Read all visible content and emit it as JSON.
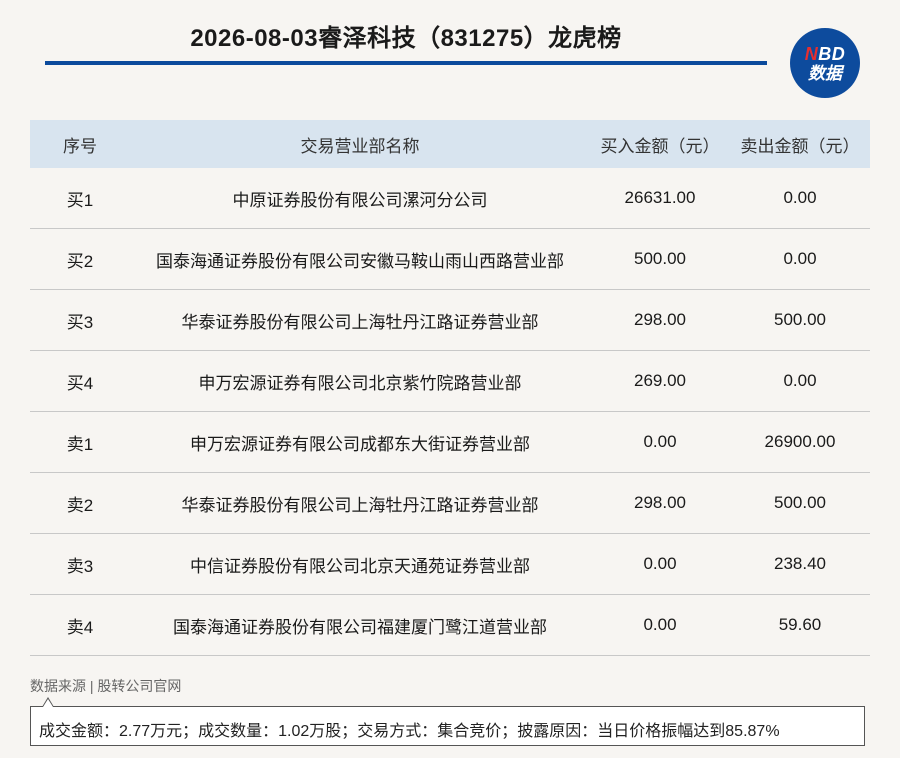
{
  "title": "2026-08-03睿泽科技（831275）龙虎榜",
  "logo": {
    "line1_n": "N",
    "line1_rest": "BD",
    "line2": "数据"
  },
  "table": {
    "headers": [
      "序号",
      "交易营业部名称",
      "买入金额（元）",
      "卖出金额（元）"
    ],
    "rows": [
      [
        "买1",
        "中原证券股份有限公司漯河分公司",
        "26631.00",
        "0.00"
      ],
      [
        "买2",
        "国泰海通证券股份有限公司安徽马鞍山雨山西路营业部",
        "500.00",
        "0.00"
      ],
      [
        "买3",
        "华泰证券股份有限公司上海牡丹江路证券营业部",
        "298.00",
        "500.00"
      ],
      [
        "买4",
        "申万宏源证券有限公司北京紫竹院路营业部",
        "269.00",
        "0.00"
      ],
      [
        "卖1",
        "申万宏源证券有限公司成都东大街证券营业部",
        "0.00",
        "26900.00"
      ],
      [
        "卖2",
        "华泰证券股份有限公司上海牡丹江路证券营业部",
        "298.00",
        "500.00"
      ],
      [
        "卖3",
        "中信证券股份有限公司北京天通苑证券营业部",
        "0.00",
        "238.40"
      ],
      [
        "卖4",
        "国泰海通证券股份有限公司福建厦门鹭江道营业部",
        "0.00",
        "59.60"
      ]
    ]
  },
  "source": "数据来源 | 股转公司官网",
  "note": "成交金额：2.77万元；成交数量：1.02万股；交易方式：集合竞价；披露原因：当日价格振幅达到85.87%"
}
